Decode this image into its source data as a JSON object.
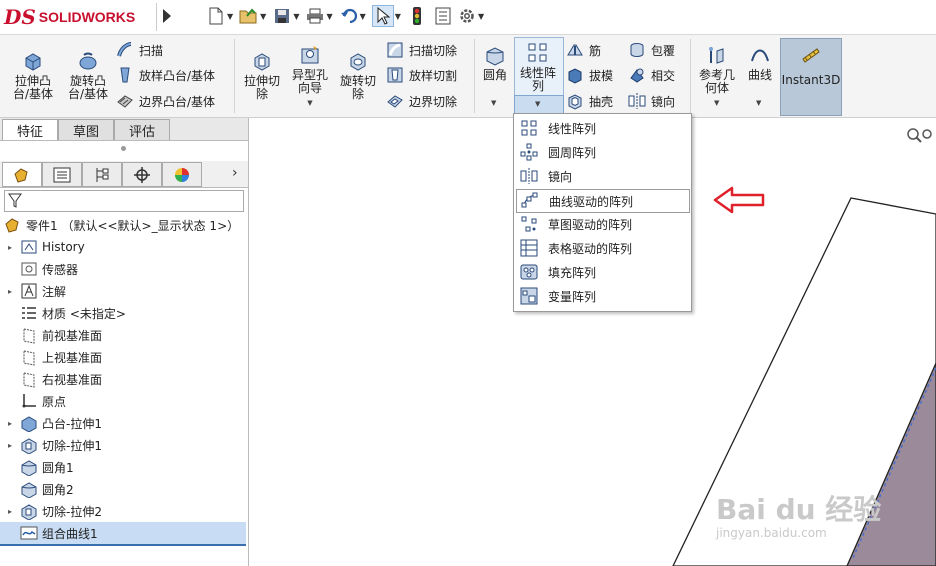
{
  "app": {
    "brand_ds": "DS",
    "brand_name": "SOLIDWORKS"
  },
  "ribbon": {
    "extrude_boss": "拉伸凸\n台/基体",
    "revolve_boss": "旋转凸\n台/基体",
    "sweep": "扫描",
    "loft_boss": "放样凸台/基体",
    "boundary_boss": "边界凸台/基体",
    "extrude_cut": "拉伸切\n除",
    "hole_wizard": "异型孔\n向导",
    "revolve_cut": "旋转切\n除",
    "swept_cut": "扫描切除",
    "lofted_cut": "放样切割",
    "boundary_cut": "边界切除",
    "fillet": "圆角",
    "linear_pattern": "线性阵\n列",
    "rib": "筋",
    "draft": "拔模",
    "shell": "抽壳",
    "wrap": "包覆",
    "intersect": "相交",
    "mirror": "镜向",
    "ref_geometry": "参考几\n何体",
    "curves": "曲线",
    "instant3d": "Instant3D"
  },
  "panel": {
    "tabs": [
      "特征",
      "草图",
      "评估"
    ]
  },
  "tree": {
    "root": "零件1 （默认<<默认>_显示状态 1>）",
    "items": [
      {
        "label": "History",
        "expand": true
      },
      {
        "label": "传感器",
        "expand": false
      },
      {
        "label": "注解",
        "expand": true
      },
      {
        "label": "材质 <未指定>",
        "expand": false
      },
      {
        "label": "前视基准面",
        "expand": false
      },
      {
        "label": "上视基准面",
        "expand": false
      },
      {
        "label": "右视基准面",
        "expand": false
      },
      {
        "label": "原点",
        "expand": false
      },
      {
        "label": "凸台-拉伸1",
        "expand": true
      },
      {
        "label": "切除-拉伸1",
        "expand": true
      },
      {
        "label": "圆角1",
        "expand": false
      },
      {
        "label": "圆角2",
        "expand": false
      },
      {
        "label": "切除-拉伸2",
        "expand": true
      },
      {
        "label": "组合曲线1",
        "expand": false
      }
    ]
  },
  "menu": {
    "items": [
      "线性阵列",
      "圆周阵列",
      "镜向",
      "曲线驱动的阵列",
      "草图驱动的阵列",
      "表格驱动的阵列",
      "填充阵列",
      "变量阵列"
    ],
    "highlighted_index": 3
  },
  "watermark": {
    "main": "Bai du 经验",
    "sub": "jingyan.baidu.com"
  },
  "colors": {
    "brand_red": "#c8102e",
    "arrow_red": "#e0202a",
    "part_face": "#9a8a9a",
    "selection": "#c8dcf3"
  }
}
